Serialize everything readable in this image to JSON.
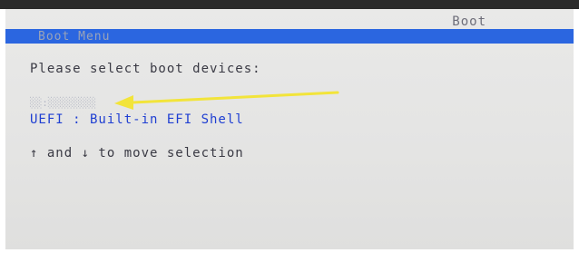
{
  "header": {
    "title": "Boot"
  },
  "menu_bar": {
    "label": "Boot Menu"
  },
  "boot": {
    "prompt": "Please select boot devices:",
    "items": [
      {
        "label": "░░:░░░░░░░░"
      },
      {
        "label": "UEFI : Built-in EFI Shell"
      }
    ],
    "hint": "↑ and ↓ to move selection"
  },
  "colors": {
    "menu_bar": "#2b66e0",
    "efi_text": "#1f3fd2",
    "annotation_arrow": "#f2e43a"
  },
  "annotation": {
    "icon": "yellow-arrow-icon",
    "points_to": "boot-item-0"
  }
}
